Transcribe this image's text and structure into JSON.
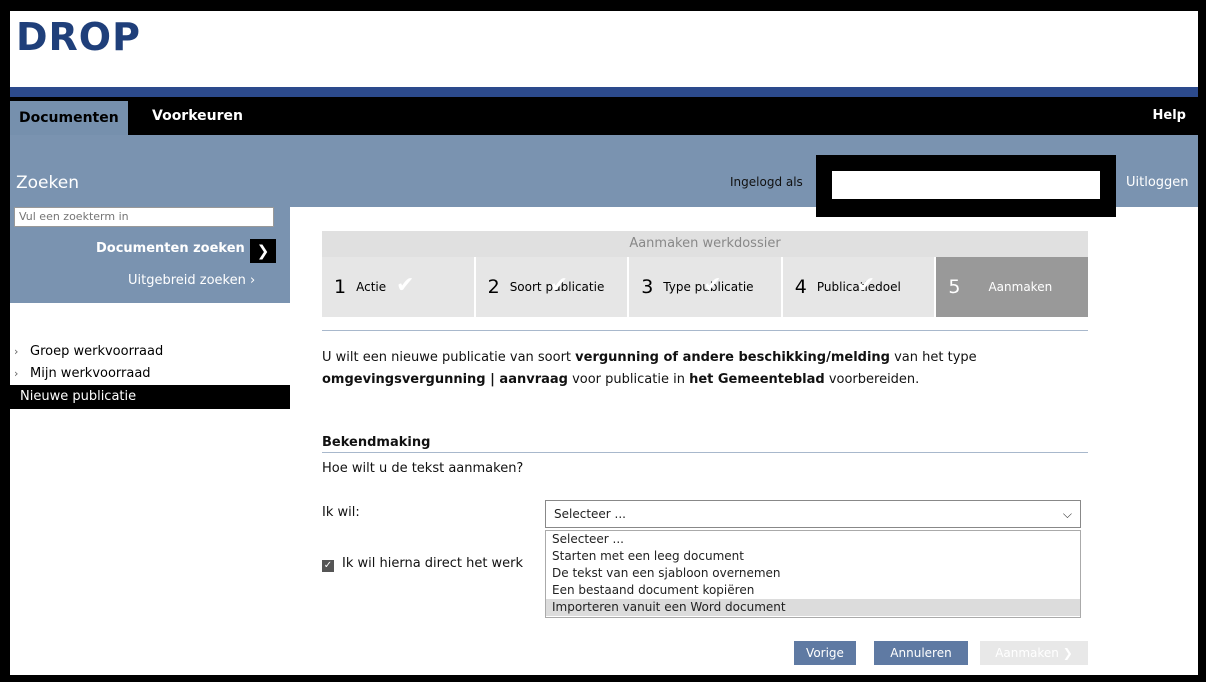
{
  "app": {
    "logo": "DROP"
  },
  "nav": {
    "tabs": [
      {
        "label": "Documenten"
      },
      {
        "label": "Voorkeuren"
      }
    ],
    "help": "Help"
  },
  "header": {
    "title": "Zoeken",
    "logged_in_label": "Ingelogd als",
    "logout": "Uitloggen"
  },
  "search": {
    "placeholder": "Vul een zoekterm in",
    "search_button": "Documenten zoeken",
    "advanced": "Uitgebreid zoeken"
  },
  "sidebar": {
    "items": [
      {
        "label": "Groep werkvoorraad"
      },
      {
        "label": "Mijn werkvoorraad"
      },
      {
        "label": "Nieuwe publicatie"
      }
    ]
  },
  "wizard": {
    "title": "Aanmaken werkdossier",
    "steps": [
      {
        "num": "1",
        "label": "Actie"
      },
      {
        "num": "2",
        "label": "Soort publicatie"
      },
      {
        "num": "3",
        "label": "Type publicatie"
      },
      {
        "num": "4",
        "label": "Publicatiedoel"
      },
      {
        "num": "5",
        "label": "Aanmaken"
      }
    ]
  },
  "intro": {
    "t1": "U wilt een nieuwe publicatie van soort ",
    "b1": "vergunning of andere beschikking/melding",
    "t2": " van het type ",
    "b2": "omgevingsvergunning | aanvraag",
    "t3": " voor publicatie in ",
    "b3": "het Gemeenteblad",
    "t4": " voorbereiden."
  },
  "bekendmaking": {
    "title": "Bekendmaking",
    "question": "Hoe wilt u de tekst aanmaken?",
    "ik_wil": "Ik wil:",
    "selected": "Selecteer ...",
    "options": [
      {
        "label": "Selecteer ..."
      },
      {
        "label": "Starten met een leeg document"
      },
      {
        "label": "De tekst van een sjabloon overnemen"
      },
      {
        "label": "Een bestaand document kopiëren"
      },
      {
        "label": "Importeren vanuit een Word document"
      }
    ],
    "checkbox_label": "Ik wil hierna direct het werk"
  },
  "buttons": {
    "vorige": "Vorige",
    "annuleren": "Annuleren",
    "aanmaken": "Aanmaken"
  }
}
